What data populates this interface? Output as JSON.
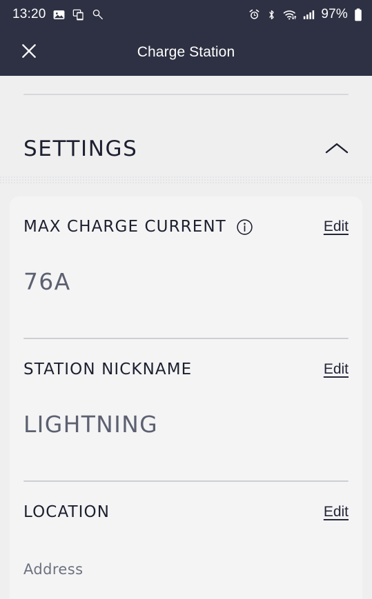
{
  "status_bar": {
    "time": "13:20",
    "battery_percent": "97%",
    "left_icons": [
      "photo-icon",
      "screen-mirror-icon",
      "magnifier-icon"
    ],
    "right_icons": [
      "alarm-icon",
      "bluetooth-icon",
      "wifi-icon",
      "cellular-signal-icon",
      "battery-icon"
    ],
    "background_color": "#2e3143",
    "foreground_color": "#ffffff"
  },
  "app_bar": {
    "close_label": "close-icon",
    "title": "Charge Station"
  },
  "section": {
    "title": "SETTINGS",
    "expanded": true,
    "toggle_icon": "chevron-up-icon"
  },
  "fields": [
    {
      "label": "MAX CHARGE CURRENT",
      "has_info": true,
      "info_icon": "info-circle-icon",
      "edit_label": "Edit",
      "value": "76A"
    },
    {
      "label": "STATION NICKNAME",
      "has_info": false,
      "edit_label": "Edit",
      "value": "LIGHTNING"
    },
    {
      "label": "LOCATION",
      "has_info": false,
      "edit_label": "Edit",
      "sub_label": "Address"
    }
  ],
  "colors": {
    "page_background": "#efeff0",
    "card_background": "#f4f4f5",
    "header": "#2e3143",
    "text_primary": "#1c1f2e",
    "text_secondary": "#5c6070",
    "divider": "#cdced2"
  }
}
